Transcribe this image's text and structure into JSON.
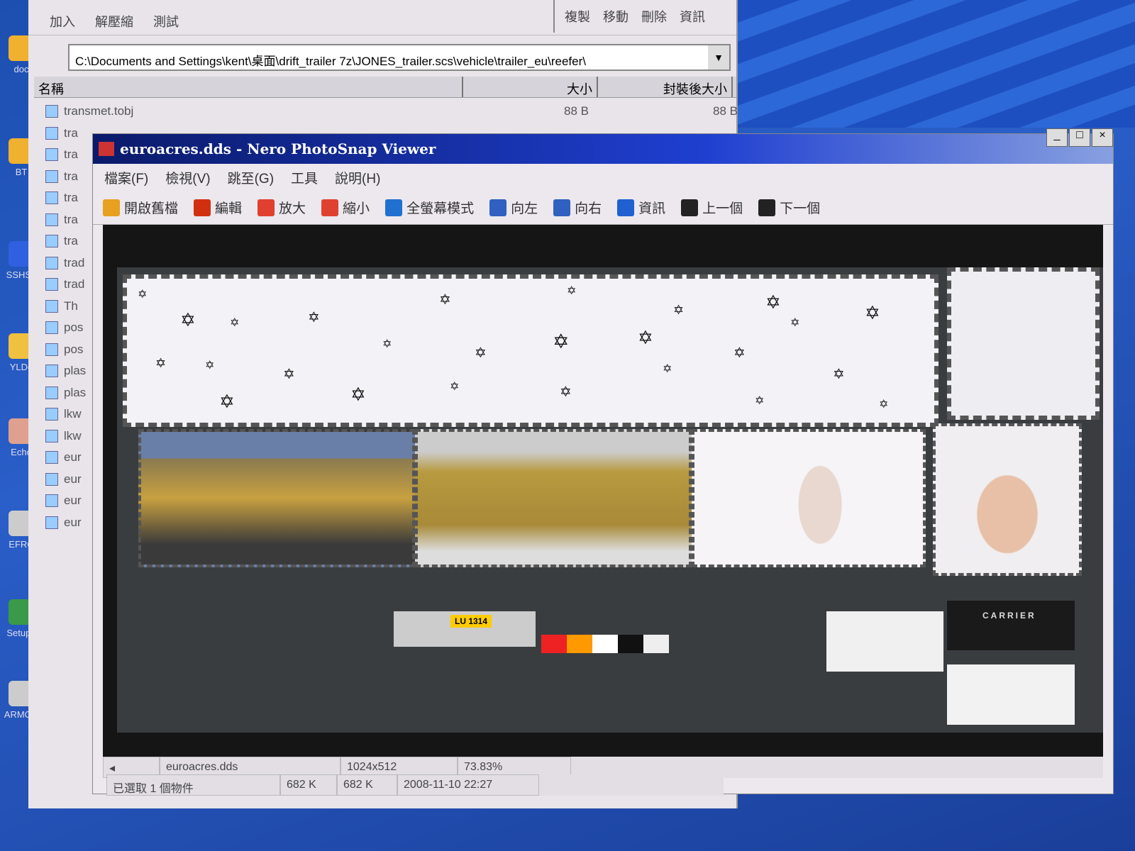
{
  "desktop": {
    "icons": [
      "doc",
      "BT",
      "SSHSe",
      "YLDe",
      "Echo",
      "EFRC",
      "Setup_",
      "ARMOR"
    ]
  },
  "archiver": {
    "toolbar_left": [
      "加入",
      "解壓縮",
      "測試"
    ],
    "toolbar_right": [
      "複製",
      "移動",
      "刪除",
      "資訊"
    ],
    "address": "C:\\Documents and Settings\\kent\\桌面\\drift_trailer 7z\\JONES_trailer.scs\\vehicle\\trailer_eu\\reefer\\",
    "columns": [
      "名稱",
      "大小",
      "封裝後大小"
    ],
    "files": [
      {
        "name": "transmet.tobj",
        "size": "88 B",
        "packed": "88 B"
      },
      {
        "name": "tra"
      },
      {
        "name": "tra"
      },
      {
        "name": "tra"
      },
      {
        "name": "tra"
      },
      {
        "name": "tra"
      },
      {
        "name": "tra"
      },
      {
        "name": "trad"
      },
      {
        "name": "trad"
      },
      {
        "name": "Th"
      },
      {
        "name": "pos"
      },
      {
        "name": "pos"
      },
      {
        "name": "plas"
      },
      {
        "name": "plas"
      },
      {
        "name": "lkw"
      },
      {
        "name": "lkw"
      },
      {
        "name": "eur"
      },
      {
        "name": "eur"
      },
      {
        "name": "eur"
      },
      {
        "name": "eur"
      }
    ],
    "status": {
      "selected": "已選取 1 個物件",
      "size": "682 K",
      "packed": "682 K",
      "modified": "2008-11-10 22:27"
    }
  },
  "viewer": {
    "title": "euroacres.dds - Nero PhotoSnap Viewer",
    "window_buttons": [
      "_",
      "□",
      "×"
    ],
    "menu": [
      "檔案(F)",
      "檢視(V)",
      "跳至(G)",
      "工具",
      "說明(H)"
    ],
    "toolbar": [
      {
        "label": "開啟舊檔",
        "icon": "folder-open-icon",
        "color": "#e8a020"
      },
      {
        "label": "編輯",
        "icon": "edit-icon",
        "color": "#d03010"
      },
      {
        "label": "放大",
        "icon": "zoom-in-icon",
        "color": "#e04030"
      },
      {
        "label": "縮小",
        "icon": "zoom-out-icon",
        "color": "#e04030"
      },
      {
        "label": "全螢幕模式",
        "icon": "fullscreen-icon",
        "color": "#2070d0"
      },
      {
        "label": "向左",
        "icon": "rotate-left-icon",
        "color": "#3060c0"
      },
      {
        "label": "向右",
        "icon": "rotate-right-icon",
        "color": "#3060c0"
      },
      {
        "label": "資訊",
        "icon": "info-icon",
        "color": "#2060d0"
      },
      {
        "label": "上一個",
        "icon": "arrow-left-icon",
        "color": "#222222"
      },
      {
        "label": "下一個",
        "icon": "arrow-right-icon",
        "color": "#222222"
      }
    ],
    "image_labels": {
      "plate": "LU 1314",
      "brand": "CARRIER"
    },
    "status": {
      "file": "euroacres.dds",
      "dimensions": "1024x512",
      "zoom": "73.83%"
    }
  }
}
